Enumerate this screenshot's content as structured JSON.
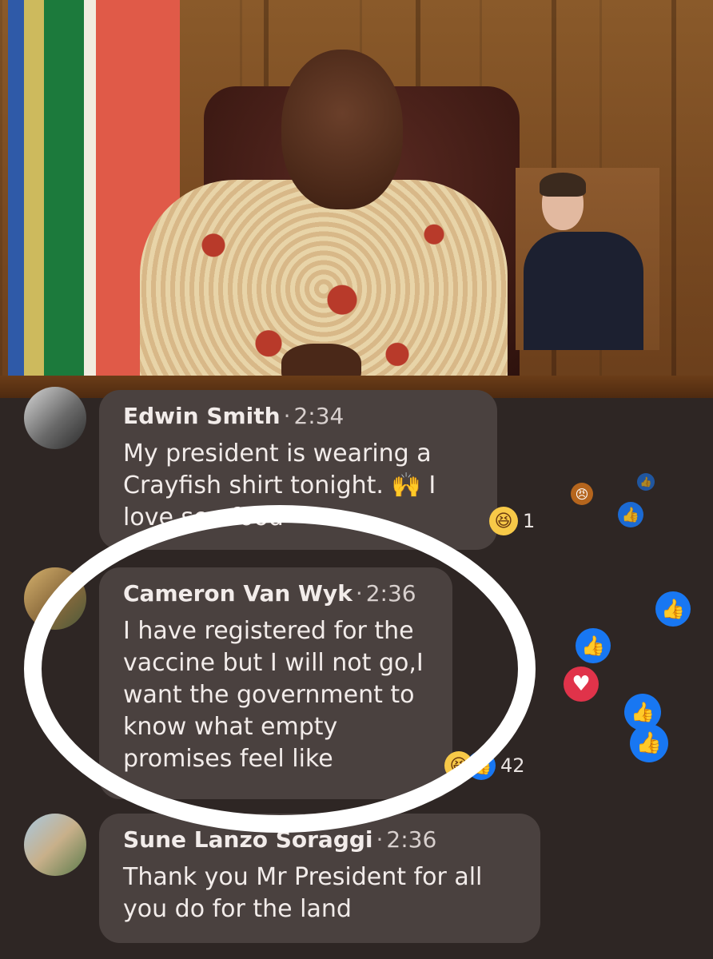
{
  "comments": [
    {
      "author": "Edwin Smith",
      "separator": "·",
      "time": "2:34",
      "text": "My president is wearing a Crayfish shirt tonight. 🙌 I love sea food",
      "reactions": {
        "icons": [
          "haha-icon"
        ],
        "count": "1"
      }
    },
    {
      "author": "Cameron Van Wyk",
      "separator": "·",
      "time": "2:36",
      "text": "I have registered for the vaccine but I will not go,I want the government to know what empty promises feel like",
      "reactions": {
        "icons": [
          "haha-icon",
          "like-icon"
        ],
        "count": "42"
      }
    },
    {
      "author": "Sune Lanzo Soraggi",
      "separator": "·",
      "time": "2:36",
      "text": "Thank you Mr President for all you do for the land"
    }
  ],
  "colors": {
    "background": "#2e2624",
    "bubble": "#4a413f",
    "text": "#f2ecea",
    "like": "#1877f2",
    "love": "#e0334a",
    "haha": "#f7c948",
    "highlight_circle": "#ffffff"
  },
  "icons": {
    "haha": "😆",
    "like": "👍",
    "love": "♥",
    "angry": "😠"
  }
}
